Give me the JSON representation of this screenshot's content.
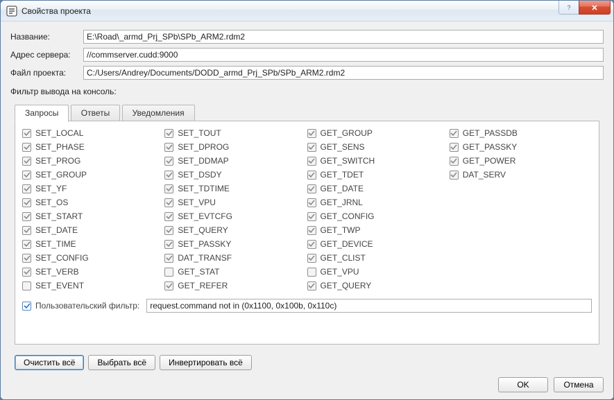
{
  "window": {
    "title": "Свойства проекта"
  },
  "form": {
    "name_label": "Название:",
    "name_value": "E:\\Road\\_armd_Prj_SPb\\SPb_ARM2.rdm2",
    "server_label": "Адрес сервера:",
    "server_value": "//commserver.cudd:9000",
    "projfile_label": "Файл проекта:",
    "projfile_value": "C:/Users/Andrey/Documents/DODD_armd_Prj_SPb/SPb_ARM2.rdm2",
    "filter_section_label": "Фильтр вывода на консоль:"
  },
  "tabs": {
    "requests": "Запросы",
    "replies": "Ответы",
    "notifications": "Уведомления"
  },
  "checks": {
    "col1": [
      {
        "label": "SET_LOCAL",
        "checked": true
      },
      {
        "label": "SET_PHASE",
        "checked": true
      },
      {
        "label": "SET_PROG",
        "checked": true
      },
      {
        "label": "SET_GROUP",
        "checked": true
      },
      {
        "label": "SET_YF",
        "checked": true
      },
      {
        "label": "SET_OS",
        "checked": true
      },
      {
        "label": "SET_START",
        "checked": true
      },
      {
        "label": "SET_DATE",
        "checked": true
      },
      {
        "label": "SET_TIME",
        "checked": true
      },
      {
        "label": "SET_CONFIG",
        "checked": true
      },
      {
        "label": "SET_VERB",
        "checked": true
      },
      {
        "label": "SET_EVENT",
        "checked": false
      }
    ],
    "col2": [
      {
        "label": "SET_TOUT",
        "checked": true
      },
      {
        "label": "SET_DPROG",
        "checked": true
      },
      {
        "label": "SET_DDMAP",
        "checked": true
      },
      {
        "label": "SET_DSDY",
        "checked": true
      },
      {
        "label": "SET_TDTIME",
        "checked": true
      },
      {
        "label": "SET_VPU",
        "checked": true
      },
      {
        "label": "SET_EVTCFG",
        "checked": true
      },
      {
        "label": "SET_QUERY",
        "checked": true
      },
      {
        "label": "SET_PASSKY",
        "checked": true
      },
      {
        "label": "DAT_TRANSF",
        "checked": true
      },
      {
        "label": "GET_STAT",
        "checked": false
      },
      {
        "label": "GET_REFER",
        "checked": true
      }
    ],
    "col3": [
      {
        "label": "GET_GROUP",
        "checked": true
      },
      {
        "label": "GET_SENS",
        "checked": true
      },
      {
        "label": "GET_SWITCH",
        "checked": true
      },
      {
        "label": "GET_TDET",
        "checked": true
      },
      {
        "label": "GET_DATE",
        "checked": true
      },
      {
        "label": "GET_JRNL",
        "checked": true
      },
      {
        "label": "GET_CONFIG",
        "checked": true
      },
      {
        "label": "GET_TWP",
        "checked": true
      },
      {
        "label": "GET_DEVICE",
        "checked": true
      },
      {
        "label": "GET_CLIST",
        "checked": true
      },
      {
        "label": "GET_VPU",
        "checked": false
      },
      {
        "label": "GET_QUERY",
        "checked": true
      }
    ],
    "col4": [
      {
        "label": "GET_PASSDB",
        "checked": true
      },
      {
        "label": "GET_PASSKY",
        "checked": true
      },
      {
        "label": "GET_POWER",
        "checked": true
      },
      {
        "label": "DAT_SERV",
        "checked": true
      }
    ]
  },
  "user_filter": {
    "label": "Пользовательский фильтр:",
    "checked": true,
    "value": "request.command not in (0x1100, 0x100b, 0x110c)"
  },
  "buttons": {
    "clear_all": "Очистить всё",
    "select_all": "Выбрать всё",
    "invert_all": "Инвертировать всё",
    "ok": "OK",
    "cancel": "Отмена"
  }
}
